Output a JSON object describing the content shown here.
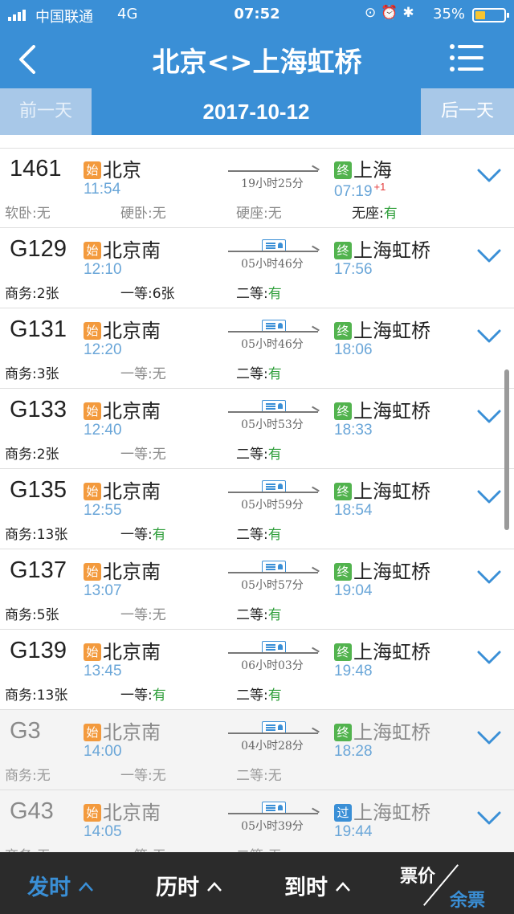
{
  "status": {
    "carrier": "中国联通",
    "network": "4G",
    "time": "07:52",
    "battery": "35%",
    "battery_level": 0.35,
    "icons": [
      "rotation-lock-icon",
      "alarm-icon",
      "bluetooth-icon"
    ]
  },
  "nav": {
    "title": "北京<>上海虹桥"
  },
  "datebar": {
    "prev": "前一天",
    "date": "2017-10-12",
    "next": "后一天"
  },
  "tags": {
    "start": "始",
    "end": "终",
    "pass": "过"
  },
  "rows": [
    {
      "train": "1461",
      "from": "北京",
      "dep": "11:54",
      "duration": "19小时25分",
      "to_tag": "终",
      "to": "上海",
      "arr": "07:19",
      "plus": "+1",
      "seats": [
        {
          "label": "软卧:",
          "val": "无"
        },
        {
          "label": "硬卧:",
          "val": "无"
        },
        {
          "label": "硬座:",
          "val": "无"
        },
        {
          "label": "无座:",
          "val": "有"
        }
      ]
    },
    {
      "train": "G129",
      "from": "北京南",
      "dep": "12:10",
      "duration": "05小时46分",
      "to_tag": "终",
      "to": "上海虹桥",
      "arr": "17:56",
      "seats": [
        {
          "label": "商务:",
          "val": "2张"
        },
        {
          "label": "一等:",
          "val": "6张"
        },
        {
          "label": "二等:",
          "val": "有"
        }
      ]
    },
    {
      "train": "G131",
      "from": "北京南",
      "dep": "12:20",
      "duration": "05小时46分",
      "to_tag": "终",
      "to": "上海虹桥",
      "arr": "18:06",
      "seats": [
        {
          "label": "商务:",
          "val": "3张"
        },
        {
          "label": "一等:",
          "val": "无"
        },
        {
          "label": "二等:",
          "val": "有"
        }
      ]
    },
    {
      "train": "G133",
      "from": "北京南",
      "dep": "12:40",
      "duration": "05小时53分",
      "to_tag": "终",
      "to": "上海虹桥",
      "arr": "18:33",
      "seats": [
        {
          "label": "商务:",
          "val": "2张"
        },
        {
          "label": "一等:",
          "val": "无"
        },
        {
          "label": "二等:",
          "val": "有"
        }
      ]
    },
    {
      "train": "G135",
      "from": "北京南",
      "dep": "12:55",
      "duration": "05小时59分",
      "to_tag": "终",
      "to": "上海虹桥",
      "arr": "18:54",
      "seats": [
        {
          "label": "商务:",
          "val": "13张"
        },
        {
          "label": "一等:",
          "val": "有"
        },
        {
          "label": "二等:",
          "val": "有"
        }
      ]
    },
    {
      "train": "G137",
      "from": "北京南",
      "dep": "13:07",
      "duration": "05小时57分",
      "to_tag": "终",
      "to": "上海虹桥",
      "arr": "19:04",
      "seats": [
        {
          "label": "商务:",
          "val": "5张"
        },
        {
          "label": "一等:",
          "val": "无"
        },
        {
          "label": "二等:",
          "val": "有"
        }
      ]
    },
    {
      "train": "G139",
      "from": "北京南",
      "dep": "13:45",
      "duration": "06小时03分",
      "to_tag": "终",
      "to": "上海虹桥",
      "arr": "19:48",
      "seats": [
        {
          "label": "商务:",
          "val": "13张"
        },
        {
          "label": "一等:",
          "val": "有"
        },
        {
          "label": "二等:",
          "val": "有"
        }
      ]
    },
    {
      "train": "G3",
      "from": "北京南",
      "dep": "14:00",
      "duration": "04小时28分",
      "to_tag": "终",
      "to": "上海虹桥",
      "arr": "18:28",
      "past": true,
      "seats": [
        {
          "label": "商务:",
          "val": "无"
        },
        {
          "label": "一等:",
          "val": "无"
        },
        {
          "label": "二等:",
          "val": "无"
        }
      ]
    },
    {
      "train": "G43",
      "from": "北京南",
      "dep": "14:05",
      "duration": "05小时39分",
      "to_tag": "过",
      "to": "上海虹桥",
      "arr": "19:44",
      "past": true,
      "seats": [
        {
          "label": "商务:",
          "val": "无"
        },
        {
          "label": "一等:",
          "val": "无"
        },
        {
          "label": "二等:",
          "val": "无"
        }
      ]
    }
  ],
  "toolbar": {
    "depart": "发时",
    "duration": "历时",
    "arrive": "到时",
    "price": "票价",
    "remain": "余票"
  },
  "colors": {
    "brand": "#3a8fd6",
    "start_tag": "#f39a3d",
    "end_tag": "#52b34e",
    "available": "#2e9e3a",
    "next_day": "#e43c3c"
  }
}
